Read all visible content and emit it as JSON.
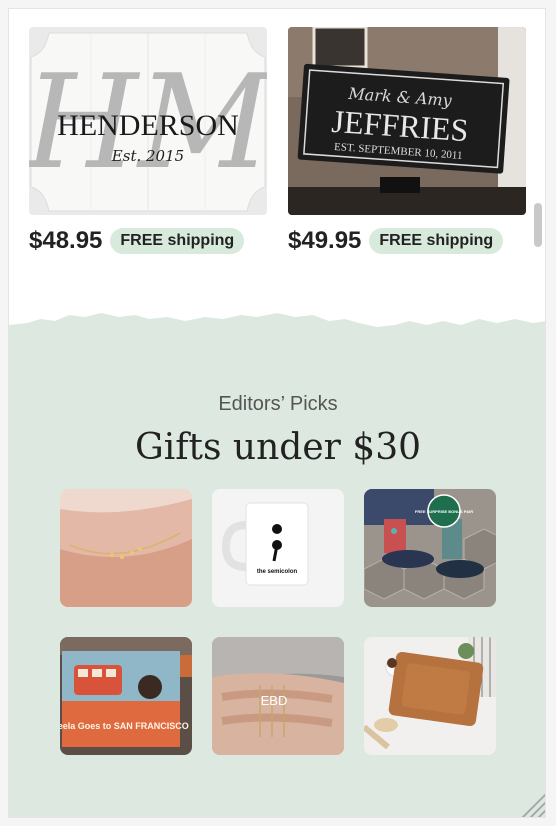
{
  "listings": [
    {
      "price": "$48.95",
      "shipping": "FREE shipping",
      "image": {
        "monogram": "HM",
        "name": "HENDERSON",
        "subtitle": "Est. 2015"
      }
    },
    {
      "price": "$49.95",
      "shipping": "FREE shipping",
      "image": {
        "script": "Mark & Amy",
        "name": "JEFFRIES",
        "subtitle": "EST. SEPTEMBER 10, 2011"
      }
    }
  ],
  "editors_picks": {
    "eyebrow": "Editors’ Picks",
    "title": "Gifts under $30",
    "tiles": [
      {
        "name": "bracelet",
        "text": ""
      },
      {
        "name": "semicolon-mug",
        "text": "the semicolon"
      },
      {
        "name": "socks",
        "text": "FREE SURPRISE BONUS PAIR"
      },
      {
        "name": "book",
        "text": "Neela Goes to SAN FRANCISCO"
      },
      {
        "name": "initial-rings",
        "text": "EBD"
      },
      {
        "name": "cutting-board",
        "text": ""
      }
    ]
  },
  "colors": {
    "mint": "#dde9e0",
    "badge": "#d8eadc",
    "accent_dark": "#222222"
  }
}
